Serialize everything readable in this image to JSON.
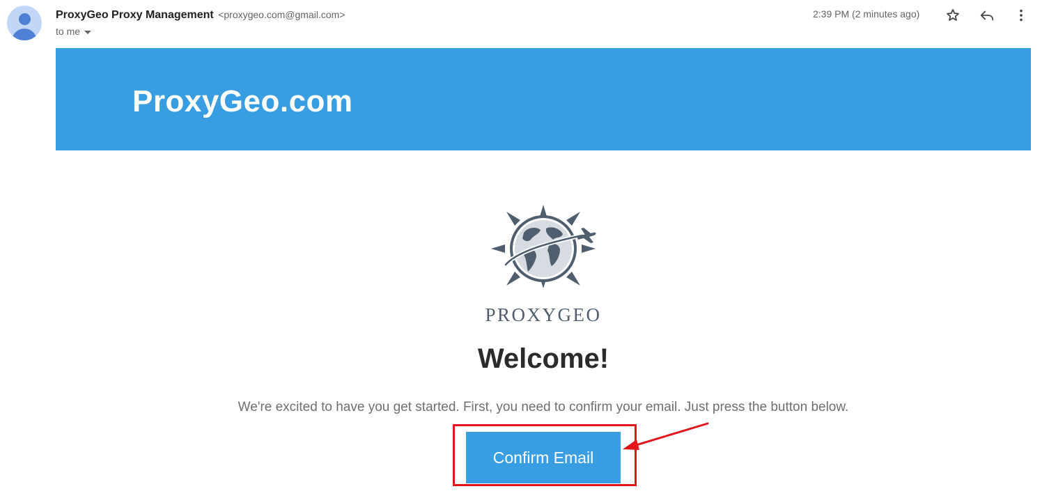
{
  "email": {
    "sender_name": "ProxyGeo Proxy Management",
    "sender_email": "<proxygeo.com@gmail.com>",
    "recipient": "to me",
    "timestamp": "2:39 PM (2 minutes ago)"
  },
  "icons": {
    "avatar": "default-avatar-icon",
    "star": "star-icon",
    "reply": "reply-icon",
    "more": "more-vert-icon",
    "recipient_toggle": "caret-down-icon"
  },
  "content": {
    "banner_title": "ProxyGeo.com",
    "logo_wordmark": "PROXYGEO",
    "heading": "Welcome!",
    "intro_text": "We're excited to have you get started. First, you need to confirm your email. Just press the button below.",
    "confirm_button_label": "Confirm Email"
  },
  "colors": {
    "brand_blue": "#389ee1",
    "annotation_red": "#e3141b",
    "logo_slate": "#4f5e6e"
  }
}
